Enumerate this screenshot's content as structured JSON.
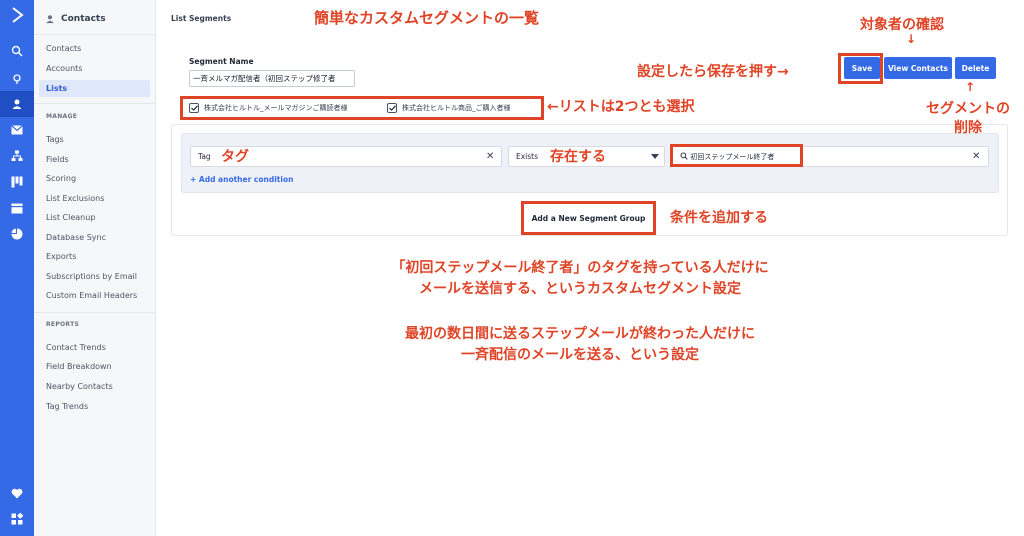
{
  "rail": {
    "items": [
      {
        "icon": "app-logo-icon"
      },
      {
        "icon": "search-icon"
      },
      {
        "icon": "location-icon"
      },
      {
        "icon": "contacts-icon",
        "active": true
      },
      {
        "icon": "mail-icon"
      },
      {
        "icon": "automation-icon"
      },
      {
        "icon": "deals-icon"
      },
      {
        "icon": "website-icon"
      },
      {
        "icon": "reports-icon"
      },
      {
        "icon": "heart-icon"
      },
      {
        "icon": "apps-icon"
      }
    ]
  },
  "sidebar": {
    "title": "Contacts",
    "items": [
      "Contacts",
      "Accounts",
      "Lists"
    ],
    "active": "Lists",
    "manage_title": "MANAGE",
    "manage_items": [
      "Tags",
      "Fields",
      "Scoring",
      "List Exclusions",
      "List Cleanup",
      "Database Sync",
      "Exports",
      "Subscriptions by Email",
      "Custom Email Headers"
    ],
    "reports_title": "REPORTS",
    "reports_items": [
      "Contact Trends",
      "Field Breakdown",
      "Nearby Contacts",
      "Tag Trends"
    ]
  },
  "main": {
    "title": "List Segments",
    "segment_name_label": "Segment Name",
    "segment_name_value": "一斉メルマガ配信者（初回ステップ修了者",
    "lists": [
      {
        "label": "株式会社ヒルトル_メールマガジンご購読者様",
        "checked": true
      },
      {
        "label": "株式会社ヒルトル商品_ご購入者様",
        "checked": true
      }
    ],
    "condition": {
      "field": "Tag",
      "operator": "Exists",
      "value": "初回ステップメール終了者"
    },
    "add_condition": "+ Add another condition",
    "add_group": "Add a New Segment Group"
  },
  "buttons": {
    "save": "Save",
    "view_contacts": "View Contacts",
    "delete": "Delete"
  },
  "annotations": {
    "list_title": "簡単なカスタムセグメントの一覧",
    "audience_check": "対象者の確認",
    "down_arrow": "↓",
    "save_hint": "設定したら保存を押す→",
    "lists_hint": "←リストは2つとも選択",
    "up_arrow": "↑",
    "delete_line1": "セグメントの",
    "delete_line2": "削除",
    "tag": "タグ",
    "exists": "存在する",
    "add_condition": "条件を追加する",
    "desc1_line1": "「初回ステップメール終了者」のタグを持っている人だけに",
    "desc1_line2": "メールを送信する、というカスタムセグメント設定",
    "desc2_line1": "最初の数日間に送るステップメールが終わった人だけに",
    "desc2_line2": "一斉配信のメールを送る、という設定"
  },
  "colors": {
    "accent": "#356ae6",
    "annotation": "#e04427",
    "rail": "#356ae6"
  }
}
